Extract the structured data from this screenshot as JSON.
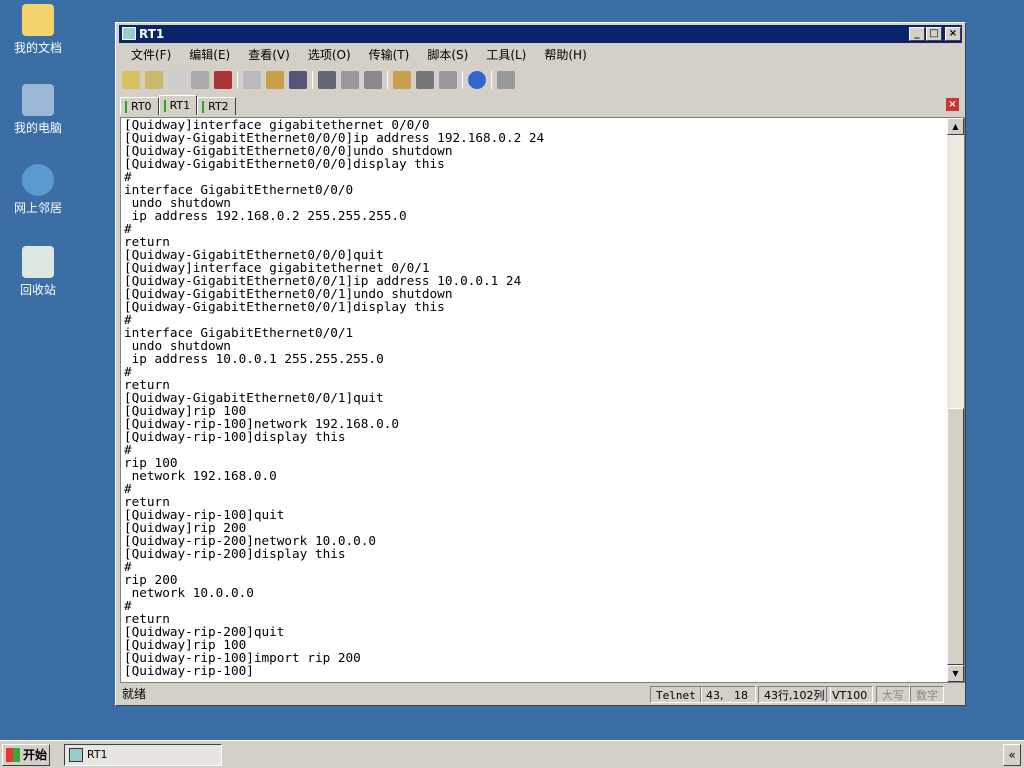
{
  "desktop": {
    "icons": [
      "我的文档",
      "我的电脑",
      "网上邻居",
      "回收站"
    ]
  },
  "window": {
    "title": "RT1",
    "controls": {
      "minimize": "_",
      "maximize": "□",
      "close": "×"
    }
  },
  "menu": [
    "文件(F)",
    "编辑(E)",
    "查看(V)",
    "选项(O)",
    "传输(T)",
    "脚本(S)",
    "工具(L)",
    "帮助(H)"
  ],
  "toolbar": [
    "connect-icon",
    "quick-connect-icon",
    "connect-tab-icon",
    "reconnect-icon",
    "disconnect-icon",
    "copy-icon",
    "paste-icon",
    "find-icon",
    "print-setup-icon",
    "print-selection-icon",
    "print-icon",
    "session-options-icon",
    "global-options-icon",
    "key-icon",
    "help-icon",
    "log-icon"
  ],
  "tabs": [
    {
      "label": "RT0"
    },
    {
      "label": "RT1"
    },
    {
      "label": "RT2"
    }
  ],
  "terminal": {
    "lines": [
      "[Quidway]interface gigabitethernet 0/0/0",
      "[Quidway-GigabitEthernet0/0/0]ip address 192.168.0.2 24",
      "[Quidway-GigabitEthernet0/0/0]undo shutdown",
      "[Quidway-GigabitEthernet0/0/0]display this",
      "#",
      "interface GigabitEthernet0/0/0",
      " undo shutdown",
      " ip address 192.168.0.2 255.255.255.0",
      "#",
      "return",
      "[Quidway-GigabitEthernet0/0/0]quit",
      "[Quidway]interface gigabitethernet 0/0/1",
      "[Quidway-GigabitEthernet0/0/1]ip address 10.0.0.1 24",
      "[Quidway-GigabitEthernet0/0/1]undo shutdown",
      "[Quidway-GigabitEthernet0/0/1]display this",
      "#",
      "interface GigabitEthernet0/0/1",
      " undo shutdown",
      " ip address 10.0.0.1 255.255.255.0",
      "#",
      "return",
      "[Quidway-GigabitEthernet0/0/1]quit",
      "[Quidway]rip 100",
      "[Quidway-rip-100]network 192.168.0.0",
      "[Quidway-rip-100]display this",
      "#",
      "rip 100",
      " network 192.168.0.0",
      "#",
      "return",
      "[Quidway-rip-100]quit",
      "[Quidway]rip 200",
      "[Quidway-rip-200]network 10.0.0.0",
      "[Quidway-rip-200]display this",
      "#",
      "rip 200",
      " network 10.0.0.0",
      "#",
      "return",
      "[Quidway-rip-200]quit",
      "[Quidway]rip 100",
      "[Quidway-rip-100]import rip 200",
      "[Quidway-rip-100]"
    ]
  },
  "status": {
    "ready": "就绪",
    "protocol": "Telnet",
    "cursor": "43,   18",
    "size": "43行,102列",
    "emulation": "VT100",
    "caps": "大写",
    "num": "数字"
  },
  "taskbar": {
    "start": "开始",
    "app": "RT1",
    "tray": "«"
  }
}
